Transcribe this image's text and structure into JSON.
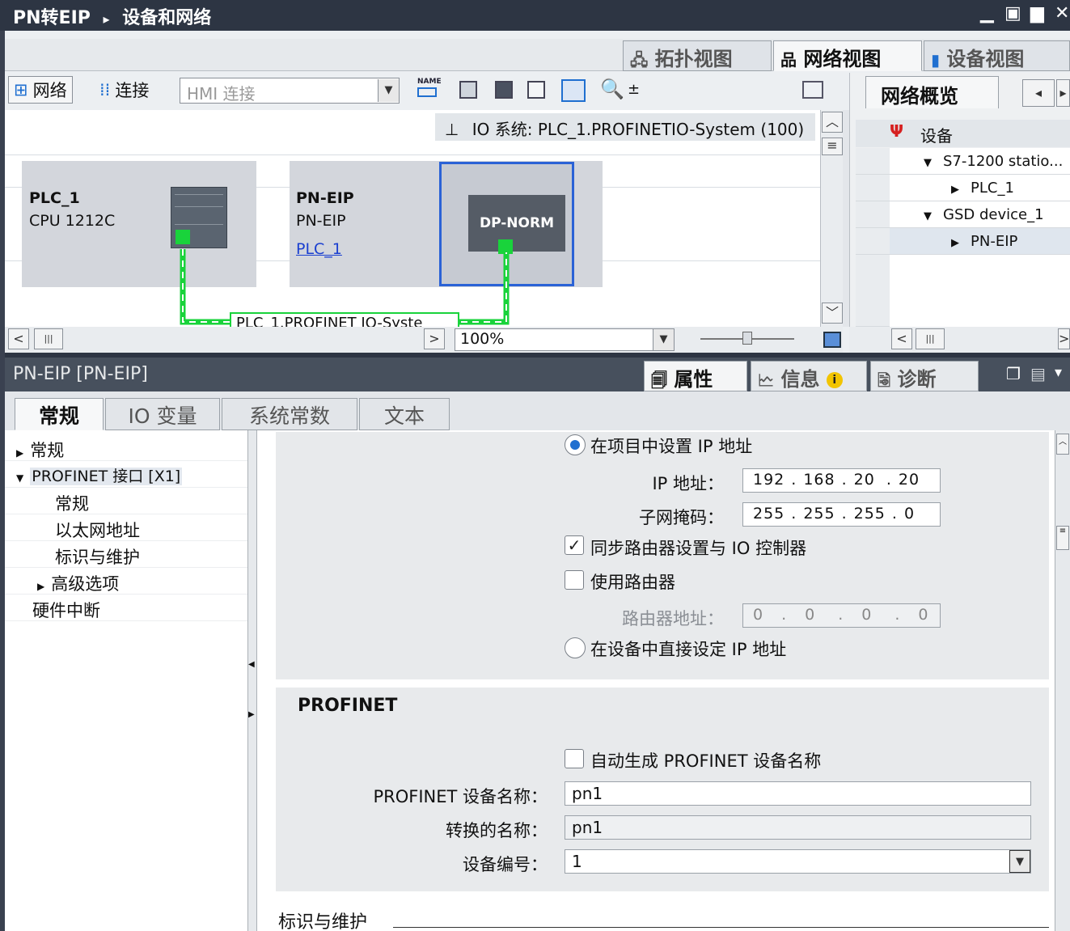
{
  "window": {
    "breadcrumb_project": "PN转EIP",
    "breadcrumb_sep": "▸",
    "breadcrumb_page": "设备和网络",
    "controls": [
      "▁",
      "▣",
      "▆",
      "✕"
    ]
  },
  "view_tabs": [
    "拓扑视图",
    "网络视图",
    "设备视图"
  ],
  "toolbar": {
    "network_label": "网络",
    "connect_label": "连接",
    "hmi_value": "HMI 连接",
    "name_icon_text": "NAME"
  },
  "canvas": {
    "io_system_label": "IO 系统: PLC_1.PROFINETIO-System (100)",
    "plc_name": "PLC_1",
    "plc_cpu": "CPU 1212C",
    "pn_name": "PN-EIP",
    "pn_type": "PN-EIP",
    "pn_link": "PLC_1",
    "dp_label": "DP-NORM",
    "network_label": "PLC_1.PROFINET IO-Syste",
    "zoom": "100%"
  },
  "overview": {
    "tab": "网络概览",
    "column": "设备",
    "rows": [
      "S7-1200 statio...",
      "PLC_1",
      "GSD device_1",
      "PN-EIP"
    ]
  },
  "props": {
    "title": "PN-EIP [PN-EIP]",
    "tabs": [
      "属性",
      "信息",
      "诊断"
    ],
    "sub_tabs": [
      "常规",
      "IO 变量",
      "系统常数",
      "文本"
    ],
    "tree": [
      "常规",
      "PROFINET 接口 [X1]",
      "常规",
      "以太网地址",
      "标识与维护",
      "高级选项",
      "硬件中断"
    ]
  },
  "ip": {
    "set_in_project": "在项目中设置 IP 地址",
    "ip_label": "IP 地址：",
    "ip_value": [
      "192",
      "168",
      "20",
      "20"
    ],
    "mask_label": "子网掩码：",
    "mask_value": [
      "255",
      "255",
      "255",
      "0"
    ],
    "sync_router": "同步路由器设置与 IO 控制器",
    "use_router": "使用路由器",
    "router_label": "路由器地址：",
    "router_value": [
      "0",
      "0",
      "0",
      "0"
    ],
    "set_direct": "在设备中直接设定 IP 地址"
  },
  "profinet": {
    "heading": "PROFINET",
    "auto_name": "自动生成 PROFINET 设备名称",
    "device_name_label": "PROFINET 设备名称：",
    "device_name": "pn1",
    "converted_label": "转换的名称：",
    "converted_name": "pn1",
    "device_number_label": "设备编号：",
    "device_number": "1"
  },
  "identification_heading": "标识与维护"
}
